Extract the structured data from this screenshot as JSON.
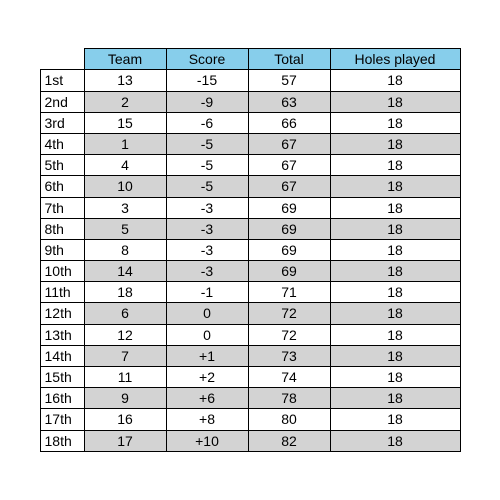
{
  "chart_data": {
    "type": "table",
    "title": "",
    "columns": [
      "Team",
      "Score",
      "Total",
      "Holes played"
    ],
    "rows": [
      {
        "rank": "1st",
        "team": 13,
        "score": -15,
        "score_str": "-15",
        "total": 57,
        "holes": 18
      },
      {
        "rank": "2nd",
        "team": 2,
        "score": -9,
        "score_str": "-9",
        "total": 63,
        "holes": 18
      },
      {
        "rank": "3rd",
        "team": 15,
        "score": -6,
        "score_str": "-6",
        "total": 66,
        "holes": 18
      },
      {
        "rank": "4th",
        "team": 1,
        "score": -5,
        "score_str": "-5",
        "total": 67,
        "holes": 18
      },
      {
        "rank": "5th",
        "team": 4,
        "score": -5,
        "score_str": "-5",
        "total": 67,
        "holes": 18
      },
      {
        "rank": "6th",
        "team": 10,
        "score": -5,
        "score_str": "-5",
        "total": 67,
        "holes": 18
      },
      {
        "rank": "7th",
        "team": 3,
        "score": -3,
        "score_str": "-3",
        "total": 69,
        "holes": 18
      },
      {
        "rank": "8th",
        "team": 5,
        "score": -3,
        "score_str": "-3",
        "total": 69,
        "holes": 18
      },
      {
        "rank": "9th",
        "team": 8,
        "score": -3,
        "score_str": "-3",
        "total": 69,
        "holes": 18
      },
      {
        "rank": "10th",
        "team": 14,
        "score": -3,
        "score_str": "-3",
        "total": 69,
        "holes": 18
      },
      {
        "rank": "11th",
        "team": 18,
        "score": -1,
        "score_str": "-1",
        "total": 71,
        "holes": 18
      },
      {
        "rank": "12th",
        "team": 6,
        "score": 0,
        "score_str": "0",
        "total": 72,
        "holes": 18
      },
      {
        "rank": "13th",
        "team": 12,
        "score": 0,
        "score_str": "0",
        "total": 72,
        "holes": 18
      },
      {
        "rank": "14th",
        "team": 7,
        "score": 1,
        "score_str": "+1",
        "total": 73,
        "holes": 18
      },
      {
        "rank": "15th",
        "team": 11,
        "score": 2,
        "score_str": "+2",
        "total": 74,
        "holes": 18
      },
      {
        "rank": "16th",
        "team": 9,
        "score": 6,
        "score_str": "+6",
        "total": 78,
        "holes": 18
      },
      {
        "rank": "17th",
        "team": 16,
        "score": 8,
        "score_str": "+8",
        "total": 80,
        "holes": 18
      },
      {
        "rank": "18th",
        "team": 17,
        "score": 10,
        "score_str": "+10",
        "total": 82,
        "holes": 18
      }
    ]
  },
  "colors": {
    "header_bg": "#87ceeb",
    "row_alt_bg": "#d3d3d3",
    "row_bg": "#ffffff",
    "border": "#000000"
  }
}
